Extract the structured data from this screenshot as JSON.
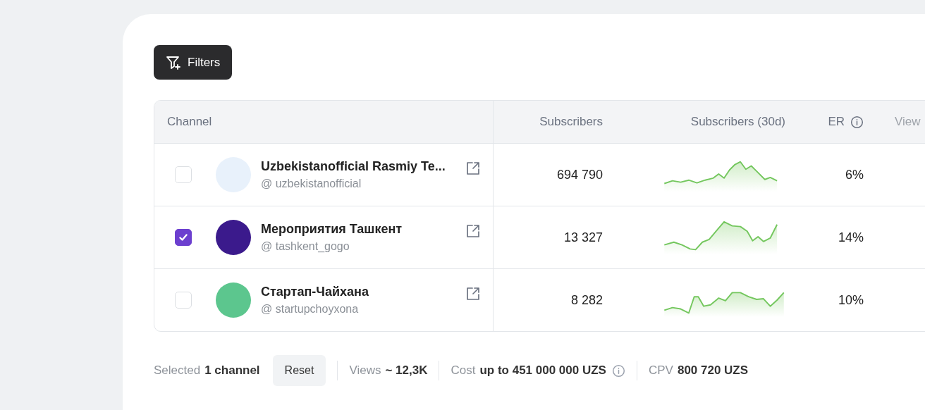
{
  "filters_button": "Filters",
  "table": {
    "columns": [
      "Channel",
      "Subscribers",
      "Subscribers (30d)",
      "ER",
      "View"
    ],
    "rows": [
      {
        "checked": false,
        "name": "Uzbekistanofficial Rasmiy Te...",
        "handle": "@ uzbekistanofficial",
        "color": "#e8f1fb",
        "subscribers": "694 790",
        "er": "6%"
      },
      {
        "checked": true,
        "name": "Мероприятия Ташкент",
        "handle": "@ tashkent_gogo",
        "color": "#3b1a8c",
        "subscribers": "13 327",
        "er": "14%"
      },
      {
        "checked": false,
        "name": "Стартап-Чайхана",
        "handle": "@ startupchoyxona",
        "color": "#5cc68e",
        "subscribers": "8 282",
        "er": "10%"
      }
    ]
  },
  "footer": {
    "selected_label": "Selected",
    "selected_value": "1 channel",
    "reset": "Reset",
    "views_label": "Views",
    "views_value": "~ 12,3K",
    "cost_label": "Cost",
    "cost_value": "up to 451 000 000 UZS",
    "cpv_label": "CPV",
    "cpv_value": "800 720 UZS"
  }
}
